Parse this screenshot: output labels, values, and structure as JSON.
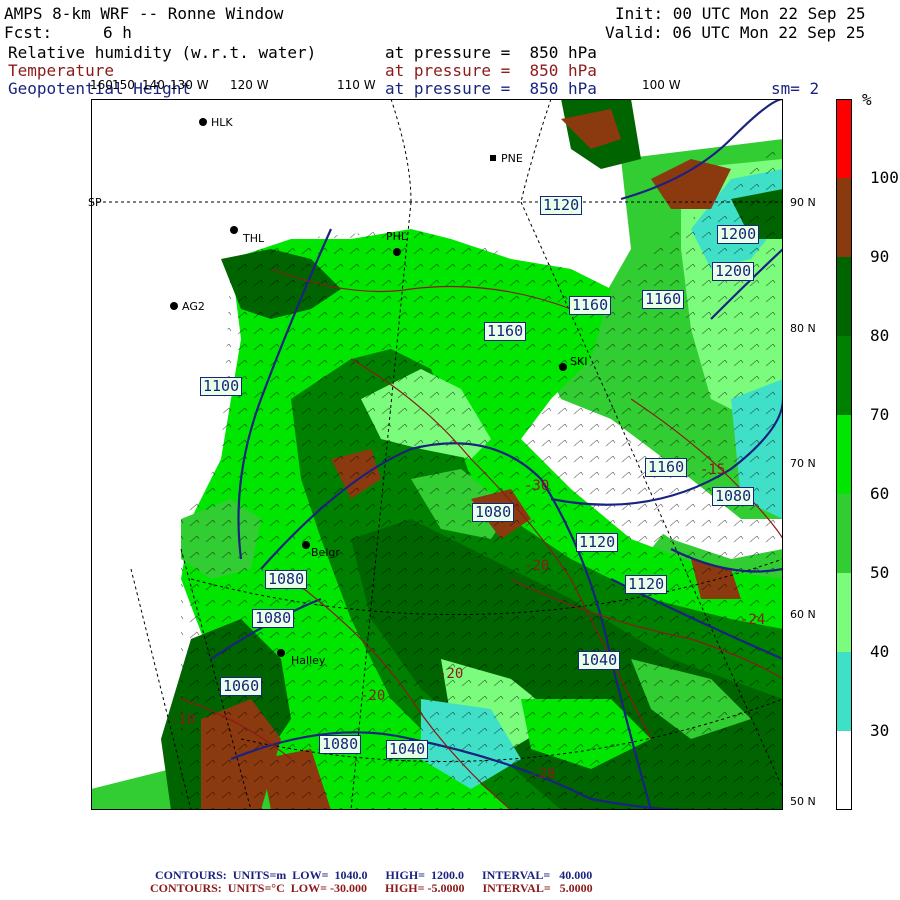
{
  "header": {
    "title": "AMPS 8-km WRF -- Ronne Window",
    "fcst_label": "Fcst:",
    "fcst_value": "6 h",
    "init": "Init: 00 UTC Mon 22 Sep 25",
    "valid": "Valid: 06 UTC Mon 22 Sep 25",
    "fields": [
      {
        "name": "Relative humidity (w.r.t. water)",
        "level": "at pressure =  850 hPa",
        "color": "#000000"
      },
      {
        "name": "Temperature",
        "level": "at pressure =  850 hPa",
        "color": "#8b1a1a"
      },
      {
        "name": "Geopotential Height",
        "level": "at pressure =  850 hPa",
        "color": "#1a237e"
      }
    ],
    "smoothing": "sm= 2"
  },
  "map": {
    "stations": [
      {
        "id": "HLK"
      },
      {
        "id": "PNE"
      },
      {
        "id": "THL"
      },
      {
        "id": "PHL"
      },
      {
        "id": "AG2"
      },
      {
        "id": "SKI"
      },
      {
        "id": "Halley"
      },
      {
        "id": "Belgr"
      }
    ],
    "lon_labels": [
      "160",
      "150",
      "140",
      "130 W",
      "120 W",
      "110 W",
      "100 W"
    ],
    "lat_labels": [
      "90 N",
      "80 N",
      "70 N",
      "60 N",
      "50 N"
    ],
    "pole_label": "SP",
    "height_contour_labels": [
      "1120",
      "1200",
      "1200",
      "1160",
      "1160",
      "1160",
      "1160",
      "1100",
      "1080",
      "1120",
      "1120",
      "1080",
      "1080",
      "1060",
      "1080",
      "1040",
      "1040",
      "1080"
    ],
    "temp_contour_labels": [
      "-30",
      "-20",
      "-20",
      "-24",
      "-20",
      "-10",
      "-20",
      "-15"
    ]
  },
  "colorbar": {
    "unit": "%",
    "levels": [
      "100",
      "90",
      "80",
      "70",
      "60",
      "50",
      "40",
      "30"
    ],
    "colors": [
      "#ff0000",
      "#8b3a0f",
      "#006400",
      "#008000",
      "#00e600",
      "#32cd32",
      "#7cfc7c",
      "#40e0c8",
      "#ffffff"
    ]
  },
  "footer": {
    "line1": "CONTOURS:  UNITS=m  LOW=  1040.0      HIGH=  1200.0      INTERVAL=   40.000",
    "line2": "CONTOURS:  UNITS=°C  LOW= -30.000      HIGH= -5.0000      INTERVAL=   5.0000"
  }
}
